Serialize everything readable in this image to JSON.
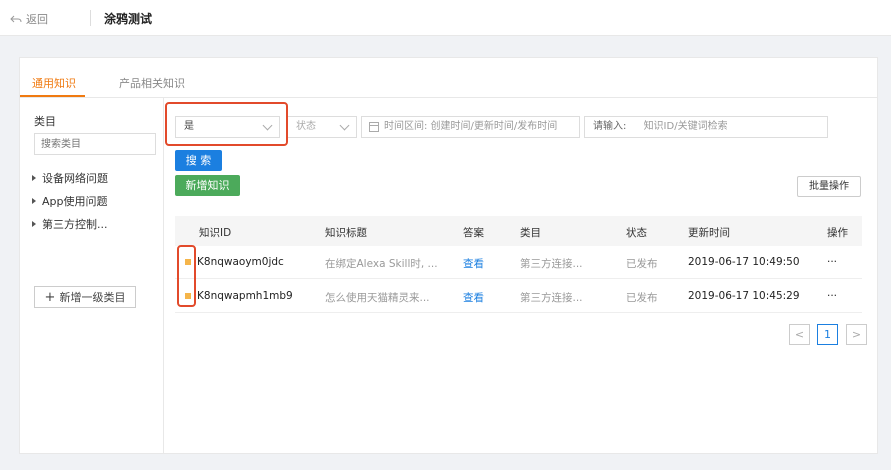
{
  "header": {
    "back_label": "返回",
    "title": "涂鸦测试"
  },
  "tabs": [
    {
      "label": "通用知识",
      "active": true
    },
    {
      "label": "产品相关知识",
      "active": false
    }
  ],
  "sidebar": {
    "title": "类目",
    "search_placeholder": "搜索类目",
    "items": [
      {
        "label": "设备网络问题"
      },
      {
        "label": "App使用问题"
      },
      {
        "label": "第三方控制..."
      }
    ],
    "add_label": "新增一级类目"
  },
  "filters": {
    "flag_select": "是",
    "status_select": "状态",
    "date_placeholder": "时间区间: 创建时间/更新时间/发布时间",
    "keyword_label": "请输入:",
    "keyword_placeholder": "知识ID/关键词检索"
  },
  "buttons": {
    "search": "搜 索",
    "new": "新增知识",
    "batch": "批量操作"
  },
  "table": {
    "columns": [
      "知识ID",
      "知识标题",
      "答案",
      "类目",
      "状态",
      "更新时间",
      "操作"
    ],
    "rows": [
      {
        "id": "K8nqwaoym0jdc",
        "title": "在绑定Alexa Skill时, ...",
        "answer": "查看",
        "category": "第三方连接...",
        "status": "已发布",
        "updated": "2019-06-17 10:49:50",
        "action": "···"
      },
      {
        "id": "K8nqwapmh1mb9",
        "title": "怎么使用天猫精灵来...",
        "answer": "查看",
        "category": "第三方连接...",
        "status": "已发布",
        "updated": "2019-06-17 10:45:29",
        "action": "···"
      }
    ]
  },
  "pagination": {
    "prev": "<",
    "current": "1",
    "next": ">"
  },
  "colors": {
    "accent": "#f07a10",
    "primary": "#1b7fe0",
    "success": "#4caa5b",
    "highlight": "#e24a2b",
    "flag": "#f5b54a"
  }
}
